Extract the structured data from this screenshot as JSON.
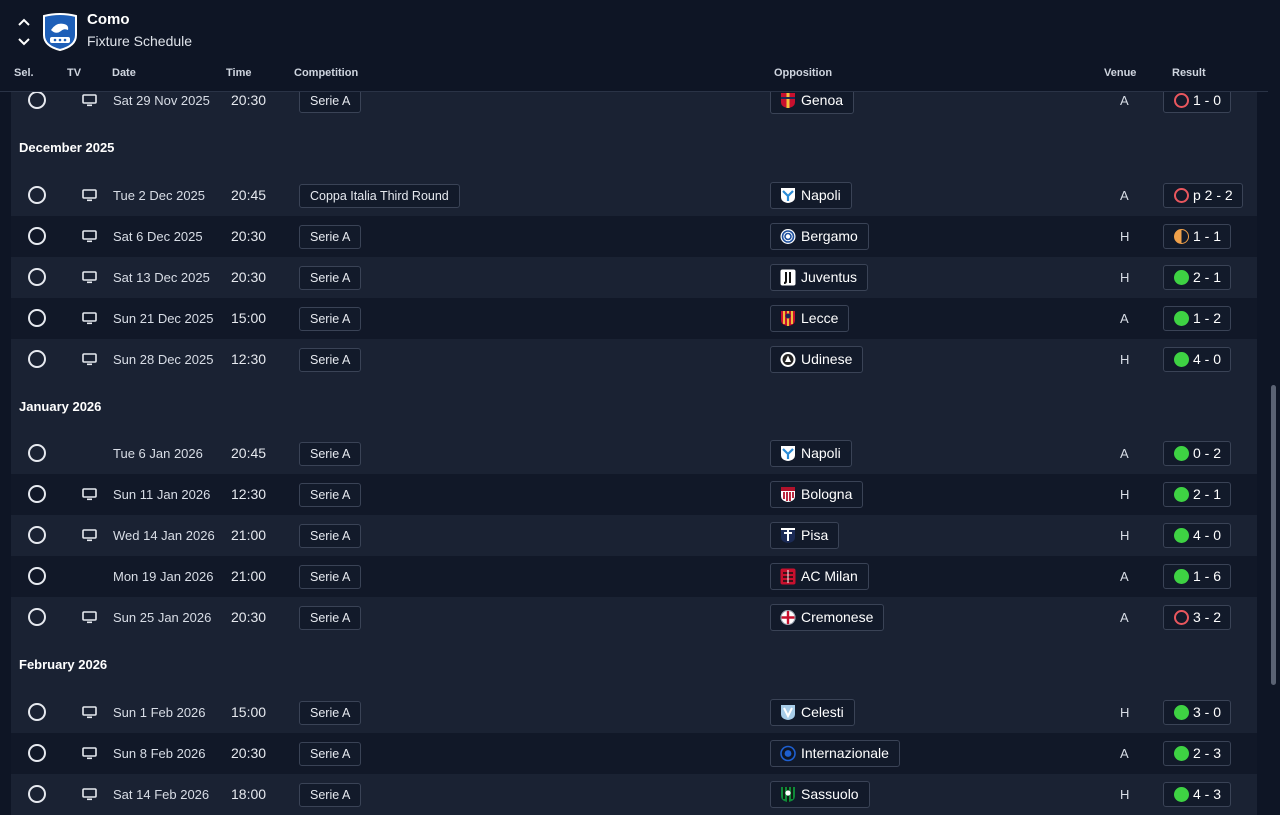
{
  "header": {
    "team_name": "Como",
    "page_title": "Fixture Schedule",
    "nav_up": "⌃",
    "nav_down": "⌄"
  },
  "columns": {
    "sel": "Sel.",
    "tv": "TV",
    "date": "Date",
    "time": "Time",
    "competition": "Competition",
    "opposition": "Opposition",
    "venue": "Venue",
    "result": "Result"
  },
  "colors": {
    "win": "#3ed243",
    "loss": "#e9575e",
    "draw": "#f0a14a"
  },
  "months": {
    "dec": "December 2025",
    "jan": "January 2026",
    "feb": "February 2026"
  },
  "fixtures": [
    {
      "date": "Sat 29 Nov 2025",
      "time": "20:30",
      "competition": "Serie A",
      "opposition": "Genoa",
      "venue": "A",
      "result": "1 - 0",
      "outcome": "loss",
      "tv": true,
      "badge": "genoa-badge"
    },
    {
      "date": "Tue 2 Dec 2025",
      "time": "20:45",
      "competition": "Coppa Italia Third Round",
      "opposition": "Napoli",
      "venue": "A",
      "result": "p 2 - 2",
      "outcome": "loss",
      "tv": true,
      "badge": "napoli-badge"
    },
    {
      "date": "Sat 6 Dec 2025",
      "time": "20:30",
      "competition": "Serie A",
      "opposition": "Bergamo",
      "venue": "H",
      "result": "1 - 1",
      "outcome": "draw",
      "tv": true,
      "badge": "bergamo-badge"
    },
    {
      "date": "Sat 13 Dec 2025",
      "time": "20:30",
      "competition": "Serie A",
      "opposition": "Juventus",
      "venue": "H",
      "result": "2 - 1",
      "outcome": "win",
      "tv": true,
      "badge": "juventus-badge"
    },
    {
      "date": "Sun 21 Dec 2025",
      "time": "15:00",
      "competition": "Serie A",
      "opposition": "Lecce",
      "venue": "A",
      "result": "1 - 2",
      "outcome": "win",
      "tv": true,
      "badge": "lecce-badge"
    },
    {
      "date": "Sun 28 Dec 2025",
      "time": "12:30",
      "competition": "Serie A",
      "opposition": "Udinese",
      "venue": "H",
      "result": "4 - 0",
      "outcome": "win",
      "tv": true,
      "badge": "udinese-badge"
    },
    {
      "date": "Tue 6 Jan 2026",
      "time": "20:45",
      "competition": "Serie A",
      "opposition": "Napoli",
      "venue": "A",
      "result": "0 - 2",
      "outcome": "win",
      "tv": false,
      "badge": "napoli-badge"
    },
    {
      "date": "Sun 11 Jan 2026",
      "time": "12:30",
      "competition": "Serie A",
      "opposition": "Bologna",
      "venue": "H",
      "result": "2 - 1",
      "outcome": "win",
      "tv": true,
      "badge": "bologna-badge"
    },
    {
      "date": "Wed 14 Jan 2026",
      "time": "21:00",
      "competition": "Serie A",
      "opposition": "Pisa",
      "venue": "H",
      "result": "4 - 0",
      "outcome": "win",
      "tv": true,
      "badge": "pisa-badge"
    },
    {
      "date": "Mon 19 Jan 2026",
      "time": "21:00",
      "competition": "Serie A",
      "opposition": "AC Milan",
      "venue": "A",
      "result": "1 - 6",
      "outcome": "win",
      "tv": false,
      "badge": "ac-milan-badge"
    },
    {
      "date": "Sun 25 Jan 2026",
      "time": "20:30",
      "competition": "Serie A",
      "opposition": "Cremonese",
      "venue": "A",
      "result": "3 - 2",
      "outcome": "loss",
      "tv": true,
      "badge": "cremonese-badge"
    },
    {
      "date": "Sun 1 Feb 2026",
      "time": "15:00",
      "competition": "Serie A",
      "opposition": "Celesti",
      "venue": "H",
      "result": "3 - 0",
      "outcome": "win",
      "tv": true,
      "badge": "celesti-badge"
    },
    {
      "date": "Sun 8 Feb 2026",
      "time": "20:30",
      "competition": "Serie A",
      "opposition": "Internazionale",
      "venue": "A",
      "result": "2 - 3",
      "outcome": "win",
      "tv": true,
      "badge": "internazionale-badge"
    },
    {
      "date": "Sat 14 Feb 2026",
      "time": "18:00",
      "competition": "Serie A",
      "opposition": "Sassuolo",
      "venue": "H",
      "result": "4 - 3",
      "outcome": "win",
      "tv": true,
      "badge": "sassuolo-badge"
    }
  ]
}
